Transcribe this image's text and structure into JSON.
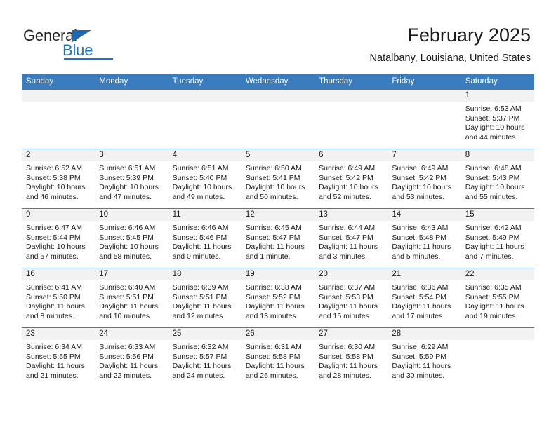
{
  "brand": {
    "name_part1": "General",
    "name_part2": "Blue",
    "triangle_icon": "blue-triangle-icon",
    "accent_color": "#1f74c0"
  },
  "header": {
    "title": "February 2025",
    "subtitle": "Natalbany, Louisiana, United States"
  },
  "calendar": {
    "header_color": "#3a7cbe",
    "day_strip_color": "#f2f2f2",
    "weekdays": [
      "Sunday",
      "Monday",
      "Tuesday",
      "Wednesday",
      "Thursday",
      "Friday",
      "Saturday"
    ],
    "weeks": [
      [
        {
          "day": "",
          "sunrise": "",
          "sunset": "",
          "daylight": "",
          "blank": true
        },
        {
          "day": "",
          "sunrise": "",
          "sunset": "",
          "daylight": "",
          "blank": true
        },
        {
          "day": "",
          "sunrise": "",
          "sunset": "",
          "daylight": "",
          "blank": true
        },
        {
          "day": "",
          "sunrise": "",
          "sunset": "",
          "daylight": "",
          "blank": true
        },
        {
          "day": "",
          "sunrise": "",
          "sunset": "",
          "daylight": "",
          "blank": true
        },
        {
          "day": "",
          "sunrise": "",
          "sunset": "",
          "daylight": "",
          "blank": true
        },
        {
          "day": "1",
          "sunrise": "Sunrise: 6:53 AM",
          "sunset": "Sunset: 5:37 PM",
          "daylight": "Daylight: 10 hours and 44 minutes.",
          "blank": false
        }
      ],
      [
        {
          "day": "2",
          "sunrise": "Sunrise: 6:52 AM",
          "sunset": "Sunset: 5:38 PM",
          "daylight": "Daylight: 10 hours and 46 minutes.",
          "blank": false
        },
        {
          "day": "3",
          "sunrise": "Sunrise: 6:51 AM",
          "sunset": "Sunset: 5:39 PM",
          "daylight": "Daylight: 10 hours and 47 minutes.",
          "blank": false
        },
        {
          "day": "4",
          "sunrise": "Sunrise: 6:51 AM",
          "sunset": "Sunset: 5:40 PM",
          "daylight": "Daylight: 10 hours and 49 minutes.",
          "blank": false
        },
        {
          "day": "5",
          "sunrise": "Sunrise: 6:50 AM",
          "sunset": "Sunset: 5:41 PM",
          "daylight": "Daylight: 10 hours and 50 minutes.",
          "blank": false
        },
        {
          "day": "6",
          "sunrise": "Sunrise: 6:49 AM",
          "sunset": "Sunset: 5:42 PM",
          "daylight": "Daylight: 10 hours and 52 minutes.",
          "blank": false
        },
        {
          "day": "7",
          "sunrise": "Sunrise: 6:49 AM",
          "sunset": "Sunset: 5:42 PM",
          "daylight": "Daylight: 10 hours and 53 minutes.",
          "blank": false
        },
        {
          "day": "8",
          "sunrise": "Sunrise: 6:48 AM",
          "sunset": "Sunset: 5:43 PM",
          "daylight": "Daylight: 10 hours and 55 minutes.",
          "blank": false
        }
      ],
      [
        {
          "day": "9",
          "sunrise": "Sunrise: 6:47 AM",
          "sunset": "Sunset: 5:44 PM",
          "daylight": "Daylight: 10 hours and 57 minutes.",
          "blank": false
        },
        {
          "day": "10",
          "sunrise": "Sunrise: 6:46 AM",
          "sunset": "Sunset: 5:45 PM",
          "daylight": "Daylight: 10 hours and 58 minutes.",
          "blank": false
        },
        {
          "day": "11",
          "sunrise": "Sunrise: 6:46 AM",
          "sunset": "Sunset: 5:46 PM",
          "daylight": "Daylight: 11 hours and 0 minutes.",
          "blank": false
        },
        {
          "day": "12",
          "sunrise": "Sunrise: 6:45 AM",
          "sunset": "Sunset: 5:47 PM",
          "daylight": "Daylight: 11 hours and 1 minute.",
          "blank": false
        },
        {
          "day": "13",
          "sunrise": "Sunrise: 6:44 AM",
          "sunset": "Sunset: 5:47 PM",
          "daylight": "Daylight: 11 hours and 3 minutes.",
          "blank": false
        },
        {
          "day": "14",
          "sunrise": "Sunrise: 6:43 AM",
          "sunset": "Sunset: 5:48 PM",
          "daylight": "Daylight: 11 hours and 5 minutes.",
          "blank": false
        },
        {
          "day": "15",
          "sunrise": "Sunrise: 6:42 AM",
          "sunset": "Sunset: 5:49 PM",
          "daylight": "Daylight: 11 hours and 7 minutes.",
          "blank": false
        }
      ],
      [
        {
          "day": "16",
          "sunrise": "Sunrise: 6:41 AM",
          "sunset": "Sunset: 5:50 PM",
          "daylight": "Daylight: 11 hours and 8 minutes.",
          "blank": false
        },
        {
          "day": "17",
          "sunrise": "Sunrise: 6:40 AM",
          "sunset": "Sunset: 5:51 PM",
          "daylight": "Daylight: 11 hours and 10 minutes.",
          "blank": false
        },
        {
          "day": "18",
          "sunrise": "Sunrise: 6:39 AM",
          "sunset": "Sunset: 5:51 PM",
          "daylight": "Daylight: 11 hours and 12 minutes.",
          "blank": false
        },
        {
          "day": "19",
          "sunrise": "Sunrise: 6:38 AM",
          "sunset": "Sunset: 5:52 PM",
          "daylight": "Daylight: 11 hours and 13 minutes.",
          "blank": false
        },
        {
          "day": "20",
          "sunrise": "Sunrise: 6:37 AM",
          "sunset": "Sunset: 5:53 PM",
          "daylight": "Daylight: 11 hours and 15 minutes.",
          "blank": false
        },
        {
          "day": "21",
          "sunrise": "Sunrise: 6:36 AM",
          "sunset": "Sunset: 5:54 PM",
          "daylight": "Daylight: 11 hours and 17 minutes.",
          "blank": false
        },
        {
          "day": "22",
          "sunrise": "Sunrise: 6:35 AM",
          "sunset": "Sunset: 5:55 PM",
          "daylight": "Daylight: 11 hours and 19 minutes.",
          "blank": false
        }
      ],
      [
        {
          "day": "23",
          "sunrise": "Sunrise: 6:34 AM",
          "sunset": "Sunset: 5:55 PM",
          "daylight": "Daylight: 11 hours and 21 minutes.",
          "blank": false
        },
        {
          "day": "24",
          "sunrise": "Sunrise: 6:33 AM",
          "sunset": "Sunset: 5:56 PM",
          "daylight": "Daylight: 11 hours and 22 minutes.",
          "blank": false
        },
        {
          "day": "25",
          "sunrise": "Sunrise: 6:32 AM",
          "sunset": "Sunset: 5:57 PM",
          "daylight": "Daylight: 11 hours and 24 minutes.",
          "blank": false
        },
        {
          "day": "26",
          "sunrise": "Sunrise: 6:31 AM",
          "sunset": "Sunset: 5:58 PM",
          "daylight": "Daylight: 11 hours and 26 minutes.",
          "blank": false
        },
        {
          "day": "27",
          "sunrise": "Sunrise: 6:30 AM",
          "sunset": "Sunset: 5:58 PM",
          "daylight": "Daylight: 11 hours and 28 minutes.",
          "blank": false
        },
        {
          "day": "28",
          "sunrise": "Sunrise: 6:29 AM",
          "sunset": "Sunset: 5:59 PM",
          "daylight": "Daylight: 11 hours and 30 minutes.",
          "blank": false
        },
        {
          "day": "",
          "sunrise": "",
          "sunset": "",
          "daylight": "",
          "blank": true
        }
      ]
    ]
  }
}
